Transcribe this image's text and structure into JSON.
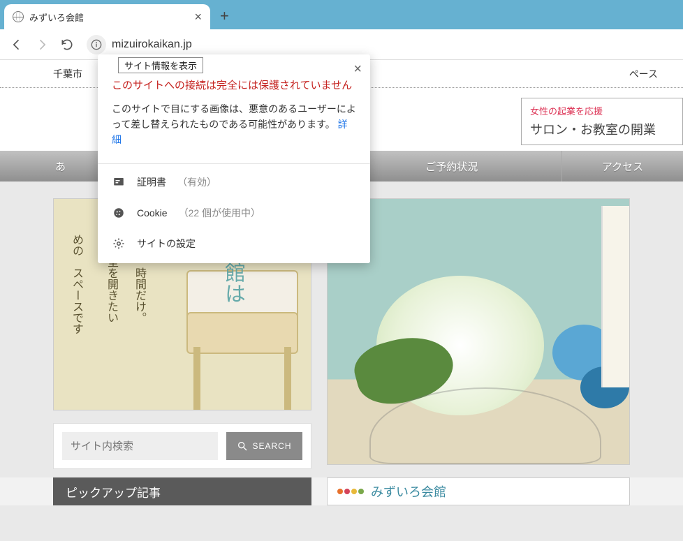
{
  "browser": {
    "tab_title": "みずいろ会館",
    "new_tab_label": "+",
    "url": "mizuirokaikan.jp"
  },
  "tooltip": "サイト情報を表示",
  "popup": {
    "warning": "このサイトへの接続は完全には保護されていません",
    "description": "このサイトで目にする画像は、悪意のあるユーザーによって差し替えられたものである可能性があります。",
    "details_link": "詳細",
    "rows": {
      "cert_label": "証明書",
      "cert_status": "（有効）",
      "cookie_label": "Cookie",
      "cookie_status": "（22 個が使用中）",
      "settings_label": "サイトの設定"
    }
  },
  "page": {
    "breadcrumb_left": "千葉市",
    "breadcrumb_right": "ペース",
    "banner_l1": "女性の起業を応援",
    "banner_l2": "サロン・お教室の開業",
    "nav": [
      "あ",
      "",
      "ご予約状況",
      "アクセス"
    ],
    "hero_vt1": "会館は",
    "hero_vt2": "時に　時間だけ。",
    "hero_vt3": "お教室を開きたい",
    "hero_vt4": "めの　スペースです",
    "search_placeholder": "サイト内検索",
    "search_button": "SEARCH",
    "pickup_heading": "ピックアップ記事",
    "right_heading": "みずいろ会館"
  }
}
